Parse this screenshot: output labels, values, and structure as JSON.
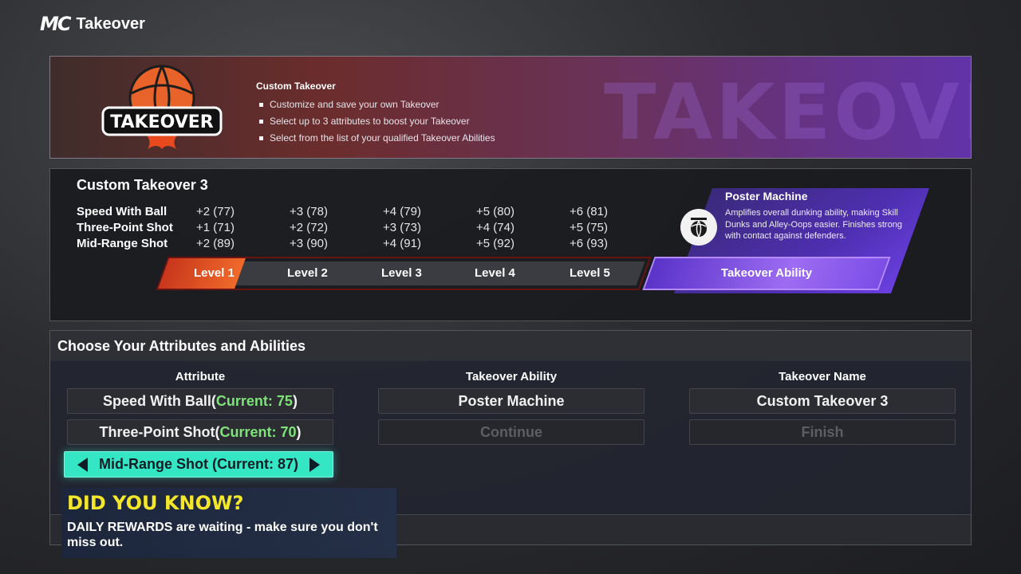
{
  "header": {
    "logo_text": "MC",
    "title": "Takeover"
  },
  "banner": {
    "logo_text": "TAKEOVER",
    "watermark": "TAKEOVER",
    "title": "Custom Takeover",
    "bullets": [
      "Customize and save your own Takeover",
      "Select up to 3 attributes to boost your Takeover",
      "Select from the list of your qualified Takeover Abilities"
    ]
  },
  "custom_takeover": {
    "title": "Custom Takeover 3",
    "attributes": [
      {
        "name": "Speed With Ball",
        "values": [
          "+2 (77)",
          "+3 (78)",
          "+4 (79)",
          "+5 (80)",
          "+6 (81)"
        ]
      },
      {
        "name": "Three-Point Shot",
        "values": [
          "+1 (71)",
          "+2 (72)",
          "+3 (73)",
          "+4 (74)",
          "+5 (75)"
        ]
      },
      {
        "name": "Mid-Range Shot",
        "values": [
          "+2 (89)",
          "+3 (90)",
          "+4 (91)",
          "+5 (92)",
          "+6 (93)"
        ]
      }
    ],
    "levels": [
      "Level 1",
      "Level 2",
      "Level 3",
      "Level 4",
      "Level 5"
    ],
    "level_progress": 0.16,
    "ability": {
      "name": "Poster Machine",
      "description": "Amplifies overall dunking ability, making Skill Dunks and Alley-Oops easier. Finishes strong with contact against defenders.",
      "button_label": "Takeover Ability",
      "icon": "basketball-dunk-icon"
    }
  },
  "choose": {
    "title": "Choose Your Attributes and Abilities",
    "columns": {
      "attribute": "Attribute",
      "ability": "Takeover Ability",
      "name": "Takeover Name"
    },
    "attribute_options": [
      {
        "name": "Speed With Ball",
        "open": " (",
        "current": "Current: 75",
        "close": ")"
      },
      {
        "name": "Three-Point Shot",
        "open": " (",
        "current": "Current: 70",
        "close": ")"
      }
    ],
    "selected_attribute": "Mid-Range Shot (Current: 87)",
    "ability_value": "Poster Machine",
    "continue_label": "Continue",
    "takeover_name_value": "Custom Takeover 3",
    "finish_label": "Finish"
  },
  "tip": {
    "title": "DID YOU KNOW?",
    "text": "DAILY REWARDS are waiting - make sure you don't miss out."
  },
  "colors": {
    "accent_teal": "#35e6c4",
    "current_green": "#7fe27a",
    "tip_yellow": "#f4e62a",
    "level_orange": "#f06a2a",
    "ability_purple": "#6a3fe0"
  }
}
